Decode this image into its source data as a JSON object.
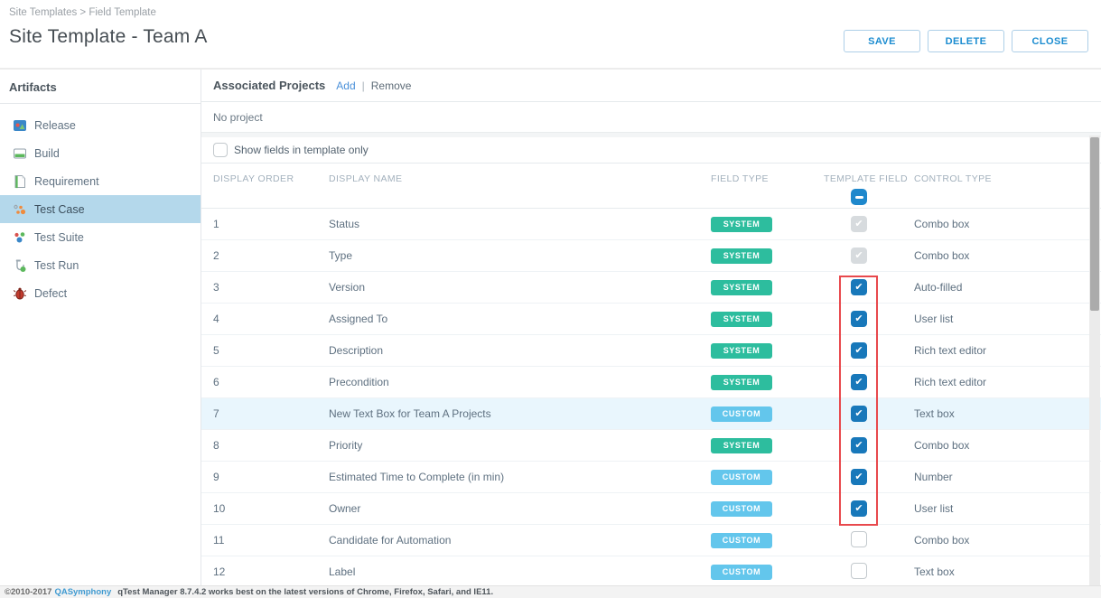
{
  "breadcrumb": "Site Templates > Field Template",
  "header": {
    "title": "Site Template - Team A",
    "buttons": [
      {
        "label": "SAVE"
      },
      {
        "label": "DELETE"
      },
      {
        "label": "CLOSE"
      }
    ]
  },
  "sidebar": {
    "title": "Artifacts",
    "items": [
      {
        "label": "Release",
        "icon": "release-icon",
        "selected": false
      },
      {
        "label": "Build",
        "icon": "build-icon",
        "selected": false
      },
      {
        "label": "Requirement",
        "icon": "requirement-icon",
        "selected": false
      },
      {
        "label": "Test Case",
        "icon": "test-case-icon",
        "selected": true
      },
      {
        "label": "Test Suite",
        "icon": "test-suite-icon",
        "selected": false
      },
      {
        "label": "Test Run",
        "icon": "test-run-icon",
        "selected": false
      },
      {
        "label": "Defect",
        "icon": "defect-icon",
        "selected": false
      }
    ]
  },
  "main": {
    "associated_projects": {
      "title": "Associated Projects",
      "add_label": "Add",
      "separator": "|",
      "remove_label": "Remove",
      "empty_text": "No project"
    },
    "filter_checkbox": {
      "label": "Show fields in template only",
      "checked": false
    },
    "table": {
      "columns": [
        "DISPLAY ORDER",
        "DISPLAY NAME",
        "FIELD TYPE",
        "TEMPLATE FIELD",
        "CONTROL TYPE"
      ],
      "header_template_checkbox_state": "indeterminate",
      "rows": [
        {
          "order": "1",
          "name": "Status",
          "field_type": "SYSTEM",
          "template_field": "checked-disabled",
          "control_type": "Combo box",
          "highlighted": false
        },
        {
          "order": "2",
          "name": "Type",
          "field_type": "SYSTEM",
          "template_field": "checked-disabled",
          "control_type": "Combo box",
          "highlighted": false
        },
        {
          "order": "3",
          "name": "Version",
          "field_type": "SYSTEM",
          "template_field": "checked",
          "control_type": "Auto-filled",
          "highlighted": false
        },
        {
          "order": "4",
          "name": "Assigned To",
          "field_type": "SYSTEM",
          "template_field": "checked",
          "control_type": "User list",
          "highlighted": false
        },
        {
          "order": "5",
          "name": "Description",
          "field_type": "SYSTEM",
          "template_field": "checked",
          "control_type": "Rich text editor",
          "highlighted": false
        },
        {
          "order": "6",
          "name": "Precondition",
          "field_type": "SYSTEM",
          "template_field": "checked",
          "control_type": "Rich text editor",
          "highlighted": false
        },
        {
          "order": "7",
          "name": "New Text Box for Team A Projects",
          "field_type": "CUSTOM",
          "template_field": "checked",
          "control_type": "Text box",
          "highlighted": true
        },
        {
          "order": "8",
          "name": "Priority",
          "field_type": "SYSTEM",
          "template_field": "checked",
          "control_type": "Combo box",
          "highlighted": false
        },
        {
          "order": "9",
          "name": "Estimated Time to Complete (in min)",
          "field_type": "CUSTOM",
          "template_field": "checked",
          "control_type": "Number",
          "highlighted": false
        },
        {
          "order": "10",
          "name": "Owner",
          "field_type": "CUSTOM",
          "template_field": "checked",
          "control_type": "User list",
          "highlighted": false
        },
        {
          "order": "11",
          "name": "Candidate for Automation",
          "field_type": "CUSTOM",
          "template_field": "unchecked",
          "control_type": "Combo box",
          "highlighted": false
        },
        {
          "order": "12",
          "name": "Label",
          "field_type": "CUSTOM",
          "template_field": "unchecked",
          "control_type": "Text box",
          "highlighted": false
        }
      ]
    }
  },
  "annotation_box": {
    "color": "#e8494d",
    "note": "red rectangle highlighting template-field checkboxes of rows 3-10"
  },
  "footer": {
    "copyright": "©2010-2017",
    "link_label": "QASymphony",
    "version_text": "qTest Manager 8.7.4.2 works best on the latest versions of Chrome, Firefox, Safari, and IE11."
  },
  "colors": {
    "accent_blue": "#1b8cd0",
    "badge_system": "#2dbd9e",
    "badge_custom": "#63c6ec",
    "checkbox_checked": "#1878ba",
    "sidebar_selected_bg": "#b4d8eb",
    "row_highlight_bg": "#e9f6fd",
    "annotation_red": "#e8494d"
  }
}
